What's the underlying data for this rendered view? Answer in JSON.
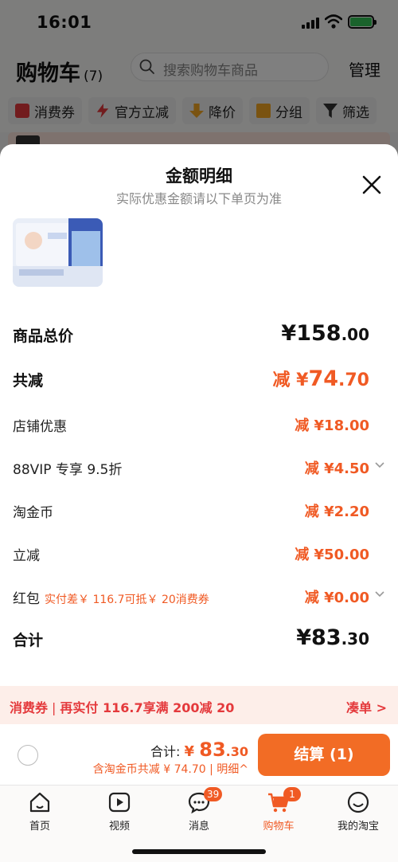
{
  "status_bar": {
    "time": "16:01"
  },
  "header": {
    "title": "购物车",
    "count": "(7)",
    "search_placeholder": "搜索购物车商品",
    "manage_label": "管理",
    "chips": [
      "消费券",
      "官方立减",
      "降价",
      "分组",
      "筛选"
    ]
  },
  "sheet": {
    "title": "金额明细",
    "subtitle": "实际优惠金额请以下单页为准",
    "rows": {
      "total_price": {
        "label": "商品总价",
        "value": "¥158",
        "cents": ".00"
      },
      "total_discount": {
        "label": "共减",
        "prefix": "减 ¥",
        "value": "74",
        "cents": ".70"
      },
      "store": {
        "label": "店铺优惠",
        "value": "减 ¥18.00"
      },
      "vip": {
        "label": "88VIP 专享 9.5折",
        "value": "减 ¥4.50"
      },
      "coin": {
        "label": "淘金币",
        "value": "减 ¥2.20"
      },
      "instant": {
        "label": "立减",
        "value": "减 ¥50.00"
      },
      "redpacket": {
        "label": "红包",
        "note": "实付差￥ 116.7可抵￥ 20消费券",
        "value": "减 ¥0.00"
      },
      "sum": {
        "label": "合计",
        "value": "¥83",
        "cents": ".30"
      }
    }
  },
  "coupon_bar": {
    "tag": "消费券",
    "text": "再实付 116.7享满 200减 20",
    "action": "凑单 >"
  },
  "checkout": {
    "total_label": "合计: ",
    "currency": "¥",
    "total_int": "83",
    "total_cents": ".30",
    "sub": "含淘金币共减 ¥ 74.70 | 明细^",
    "pay_label": "结算 (1)"
  },
  "tabbar": {
    "tabs": [
      "首页",
      "视频",
      "消息",
      "购物车",
      "我的淘宝"
    ],
    "message_badge": "39",
    "cart_badge": "1"
  },
  "colors": {
    "accent": "#f05a24",
    "pay_button": "#f26c25",
    "coupon_bg": "#fdeee9"
  }
}
